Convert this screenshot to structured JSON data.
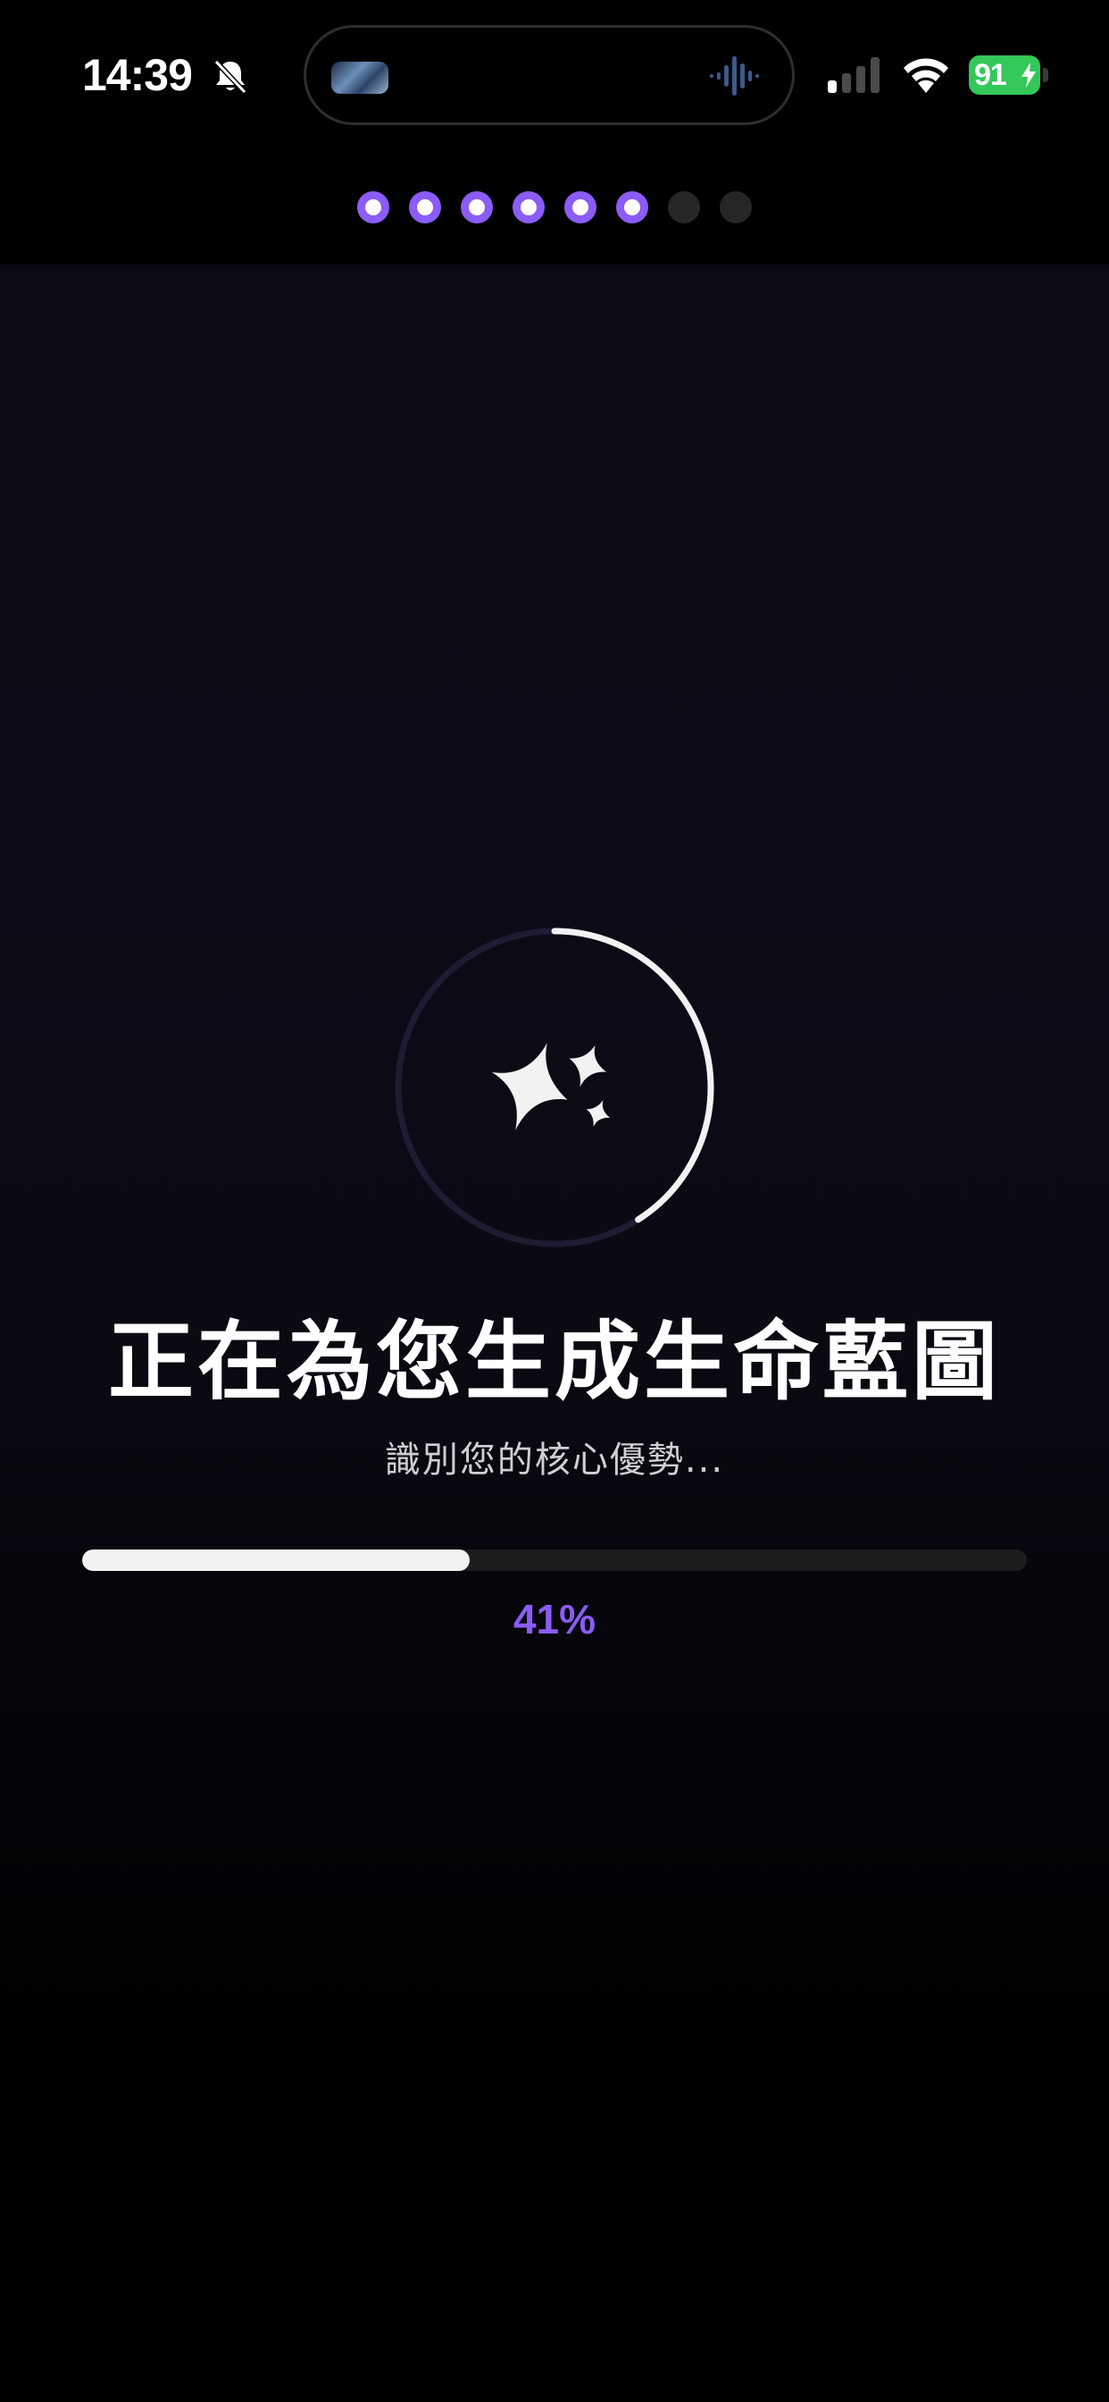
{
  "status_bar": {
    "time": "14:39",
    "battery_level": "91",
    "battery_color": "#34c759",
    "icons": [
      "bell-muted-icon",
      "waveform-icon",
      "cellular-icon",
      "wifi-icon",
      "battery-icon"
    ]
  },
  "steps": {
    "total": 8,
    "completed": 6,
    "active_color": "#8b5cf6",
    "pending_color": "#262626"
  },
  "loader": {
    "icon": "sparkles-icon",
    "ring_progress": 0.41,
    "title": "正在為您生成生命藍圖",
    "subtitle": "識別您的核心優勢...",
    "progress_value": 0.41,
    "progress_label": "41%",
    "accent_color": "#8b5cf6"
  }
}
